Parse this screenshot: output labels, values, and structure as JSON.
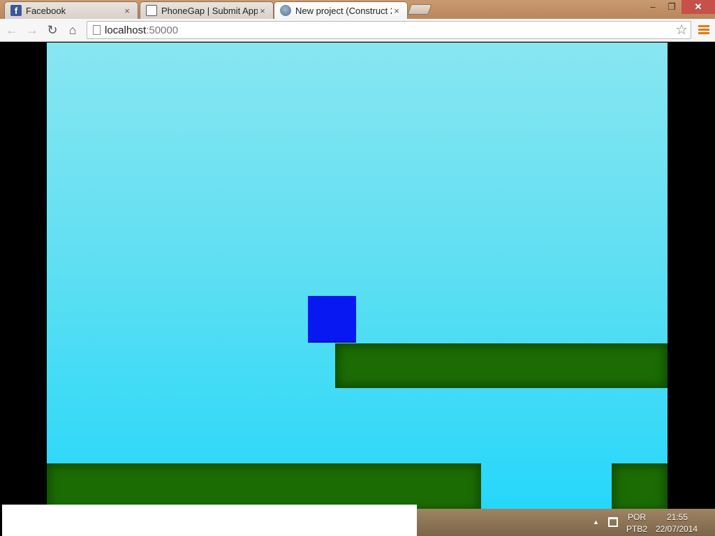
{
  "browser": {
    "tabs": [
      {
        "title": "Facebook",
        "favicon": "facebook-icon",
        "active": false
      },
      {
        "title": "PhoneGap | Submit Apps",
        "favicon": "phonegap-icon",
        "active": false
      },
      {
        "title": "New project (Construct 2 |",
        "favicon": "globe-icon",
        "active": true
      }
    ],
    "tab_close_glyph": "×",
    "window_buttons": {
      "minimize": "–",
      "restore": "❐",
      "close": "✕"
    },
    "toolbar": {
      "back": "←",
      "forward": "→",
      "reload": "↻",
      "home": "⌂",
      "url_host": "localhost",
      "url_port": ":50000",
      "bookmark": "☆"
    }
  },
  "game": {
    "sky_colors": [
      "#88e6f1",
      "#1fd6fb"
    ],
    "platform_color": "#1c6c04",
    "player_color": "#0718f2"
  },
  "taskbar": {
    "language": "POR",
    "keyboard": "PTB2",
    "time": "21:55",
    "date": "22/07/2014",
    "tray_arrow": "▲"
  }
}
